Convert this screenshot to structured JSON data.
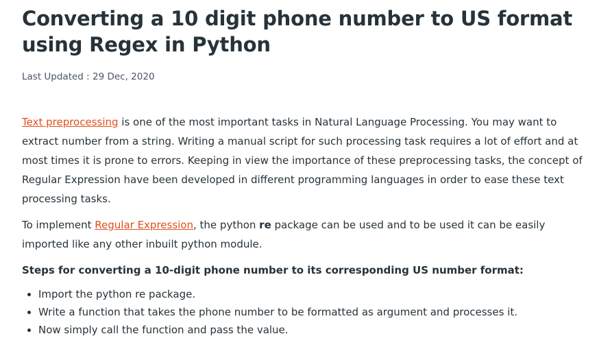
{
  "article": {
    "title": "Converting a 10 digit phone number to US format using Regex in Python",
    "last_updated": "Last Updated : 29 Dec, 2020",
    "paragraph1": {
      "link_text": "Text preprocessing",
      "text": " is one of the most important tasks in Natural Language Processing. You may want to extract number from a string. Writing a manual script for such processing task requires a lot of effort and at most times it is prone to errors. Keeping in view the importance of these preprocessing tasks, the concept of Regular Expression have been developed in different programming languages in order to ease these text processing tasks."
    },
    "paragraph2": {
      "prefix": "To implement ",
      "link_text": "Regular Expression",
      "middle": ", the python ",
      "bold": "re",
      "suffix": " package can be used and to be used it can be easily imported like any other inbuilt python module."
    },
    "steps_heading": "Steps for converting a 10-digit phone number to its corresponding US number format:",
    "steps": [
      "Import the python re package.",
      "Write a function that takes the phone number to be formatted as argument and processes it.",
      "Now simply call the function and pass the value."
    ],
    "colors": {
      "link": "#e04e1b",
      "text": "#273239"
    }
  }
}
